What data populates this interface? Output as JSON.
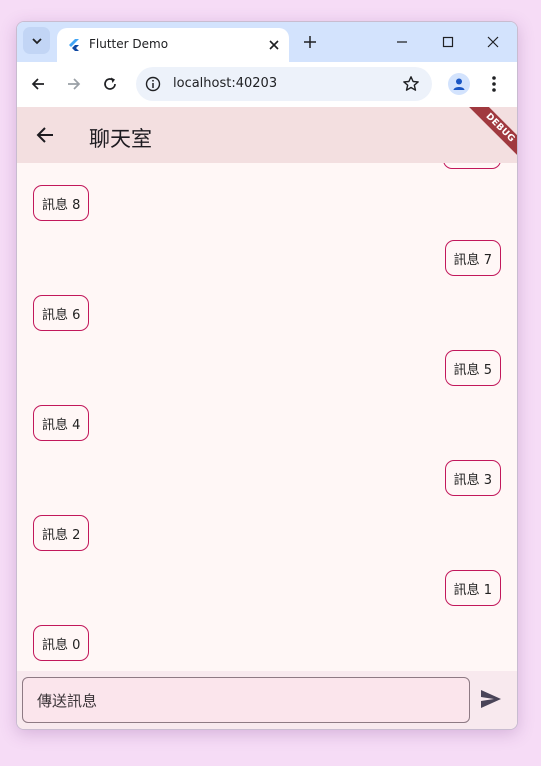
{
  "browser": {
    "tab_title": "Flutter Demo",
    "url": "localhost:40203"
  },
  "app": {
    "title": "聊天室",
    "debug_banner": "DEBUG"
  },
  "messages": [
    {
      "text": "訊息 8",
      "side": "left"
    },
    {
      "text": "訊息 7",
      "side": "right"
    },
    {
      "text": "訊息 6",
      "side": "left"
    },
    {
      "text": "訊息 5",
      "side": "right"
    },
    {
      "text": "訊息 4",
      "side": "left"
    },
    {
      "text": "訊息 3",
      "side": "right"
    },
    {
      "text": "訊息 2",
      "side": "left"
    },
    {
      "text": "訊息 1",
      "side": "right"
    },
    {
      "text": "訊息 0",
      "side": "left"
    }
  ],
  "composer": {
    "placeholder": "傳送訊息"
  },
  "colors": {
    "bubble_border": "#c2185b",
    "appbar_bg": "#f3dfe0",
    "chat_bg": "#fff7f6"
  }
}
